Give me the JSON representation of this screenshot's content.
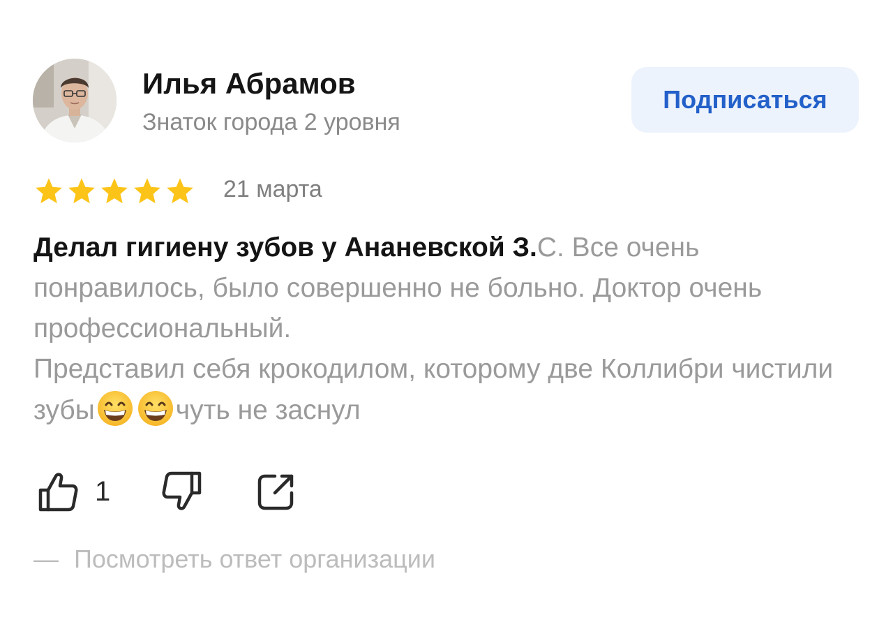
{
  "author": {
    "name": "Илья Абрамов",
    "status": "Знаток города 2 уровня"
  },
  "subscribe_label": "Подписаться",
  "rating": {
    "value": 5,
    "max": 5,
    "color": "#FCC419"
  },
  "date": "21 марта",
  "review": {
    "bold_part": "Делал гигиену зубов у Ананевской З.",
    "part1": "С. Все очень понравилось, было совершенно не больно. Доктор очень профессиональный.\nПредставил себя крокодилом, которому две Коллибри чистили зубы",
    "emoji_names": [
      "grinning-face-with-smiling-eyes",
      "grinning-face-with-smiling-eyes"
    ],
    "part2": "чуть не заснул"
  },
  "actions": {
    "like_icon": "thumbs-up-icon",
    "like_count": "1",
    "dislike_icon": "thumbs-down-icon",
    "share_icon": "share-icon"
  },
  "org_reply": {
    "dash": "—",
    "label": "Посмотреть ответ организации"
  },
  "colors": {
    "accent": "#2360C9",
    "button_bg": "#EDF3FC",
    "muted_text": "#9A9A9A"
  }
}
